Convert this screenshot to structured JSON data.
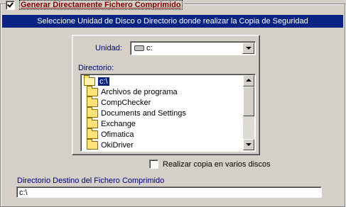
{
  "header": {
    "checkbox_label": "Generar Directamente Fichero Comprimido",
    "checked": true
  },
  "banner": {
    "text": "Seleccione Unidad de Disco o Directorio donde realizar la Copia de Seguridad"
  },
  "drive": {
    "label": "Unidad:",
    "selected": "c:",
    "icon": "drive-icon"
  },
  "directory": {
    "label": "Directorio:",
    "items": [
      {
        "name": "c:\\",
        "icon": "open-folder-icon",
        "selected": true
      },
      {
        "name": "Archivos de programa",
        "icon": "folder-icon"
      },
      {
        "name": "CompChecker",
        "icon": "folder-icon"
      },
      {
        "name": "Documents and Settings",
        "icon": "folder-icon"
      },
      {
        "name": "Exchange",
        "icon": "folder-icon"
      },
      {
        "name": "Ofimatica",
        "icon": "folder-icon"
      },
      {
        "name": "OkiDriver",
        "icon": "folder-icon"
      }
    ]
  },
  "options": {
    "multi_disk_label": "Realizar copia en varios discos",
    "multi_disk_checked": false
  },
  "destination": {
    "label": "Directorio Destino del Fichero Comprimido",
    "value": "c:\\"
  },
  "colors": {
    "banner_bg": "#0a2484",
    "label_blue": "#000080",
    "header_label": "#800000",
    "window_bg": "#d4d0c8"
  }
}
